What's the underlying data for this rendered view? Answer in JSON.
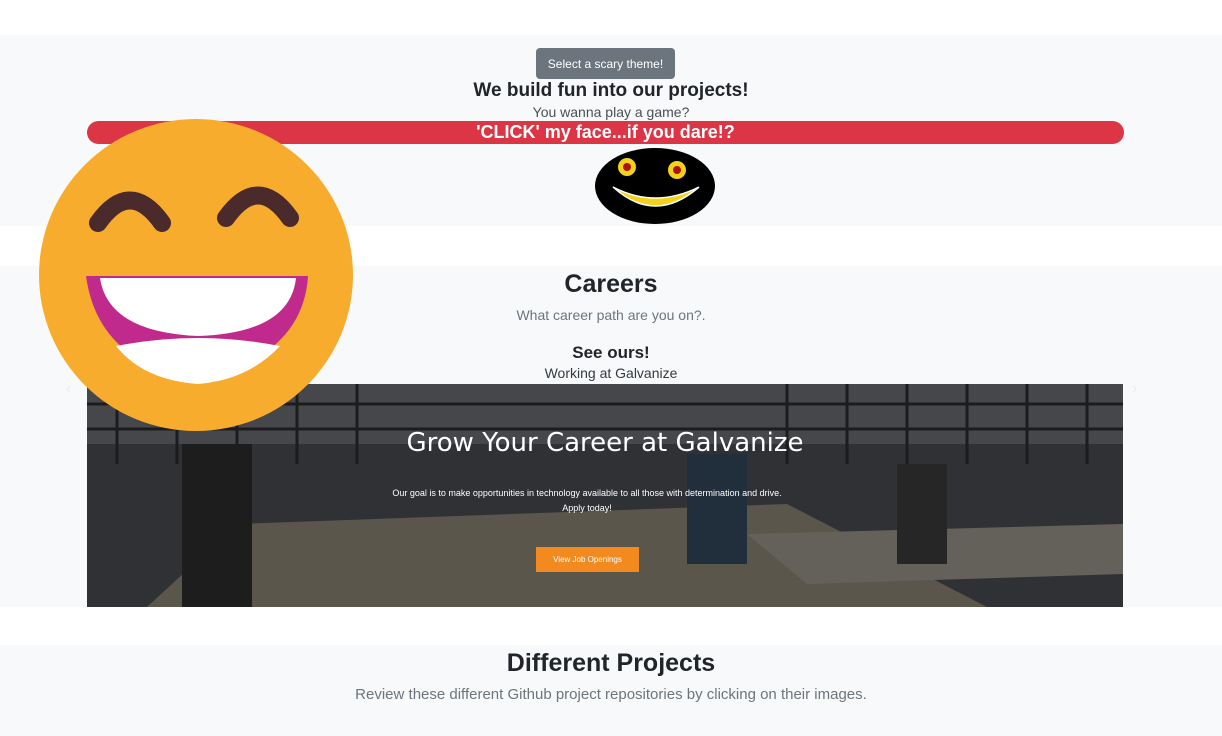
{
  "hero": {
    "theme_button": "Select a scary theme!",
    "title": "We build fun into our projects!",
    "subtitle": "You wanna play a game?",
    "click_bar": "'CLICK' my face...if you dare!?"
  },
  "careers": {
    "title": "Careers",
    "subtitle": "What career path are you on?.",
    "see_ours": "See ours!",
    "working_at": "Working at Galvanize",
    "slide": {
      "title": "Grow Your Career at Galvanize",
      "text": "Our goal is to make opportunities in technology available to all those with determination and drive. Apply today!",
      "button": "View Job Openings"
    },
    "prev_icon": "chevron-left-icon",
    "next_icon": "chevron-right-icon"
  },
  "projects": {
    "title": "Different Projects",
    "subtitle": "Review these different Github project repositories by clicking on their images."
  },
  "colors": {
    "theme_button": "#6c757d",
    "danger": "#dc3545",
    "emoji_face": "#f8ac2e",
    "emoji_mouth": "#c02a8c",
    "cta": "#f28a1f"
  }
}
